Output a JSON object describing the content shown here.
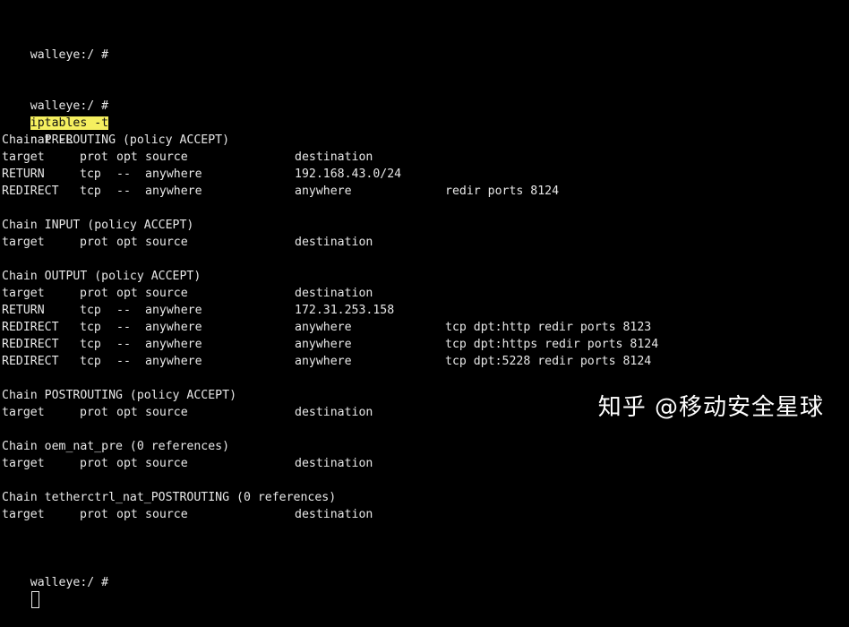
{
  "window": {
    "background": "#000000",
    "text_color": "#e8e8e8",
    "highlight_color": "#f5ef5f"
  },
  "terminal": {
    "prompt": "walleye:/ #",
    "command_highlight": "iptables -t",
    "command_rest": "nat -L",
    "header": [
      "target",
      "prot",
      "opt",
      "source",
      "destination"
    ],
    "chains": [
      {
        "title": "Chain PREROUTING (policy ACCEPT)",
        "rules": [
          [
            "RETURN",
            "tcp",
            "--",
            "anywhere",
            "192.168.43.0/24",
            ""
          ],
          [
            "REDIRECT",
            "tcp",
            "--",
            "anywhere",
            "anywhere",
            "redir ports 8124"
          ]
        ]
      },
      {
        "title": "Chain INPUT (policy ACCEPT)",
        "rules": []
      },
      {
        "title": "Chain OUTPUT (policy ACCEPT)",
        "rules": [
          [
            "RETURN",
            "tcp",
            "--",
            "anywhere",
            "172.31.253.158",
            ""
          ],
          [
            "REDIRECT",
            "tcp",
            "--",
            "anywhere",
            "anywhere",
            "tcp dpt:http redir ports 8123"
          ],
          [
            "REDIRECT",
            "tcp",
            "--",
            "anywhere",
            "anywhere",
            "tcp dpt:https redir ports 8124"
          ],
          [
            "REDIRECT",
            "tcp",
            "--",
            "anywhere",
            "anywhere",
            "tcp dpt:5228 redir ports 8124"
          ]
        ]
      },
      {
        "title": "Chain POSTROUTING (policy ACCEPT)",
        "rules": []
      },
      {
        "title": "Chain oem_nat_pre (0 references)",
        "rules": []
      },
      {
        "title": "Chain tetherctrl_nat_POSTROUTING (0 references)",
        "rules": []
      }
    ]
  },
  "watermark": "知乎 @移动安全星球"
}
